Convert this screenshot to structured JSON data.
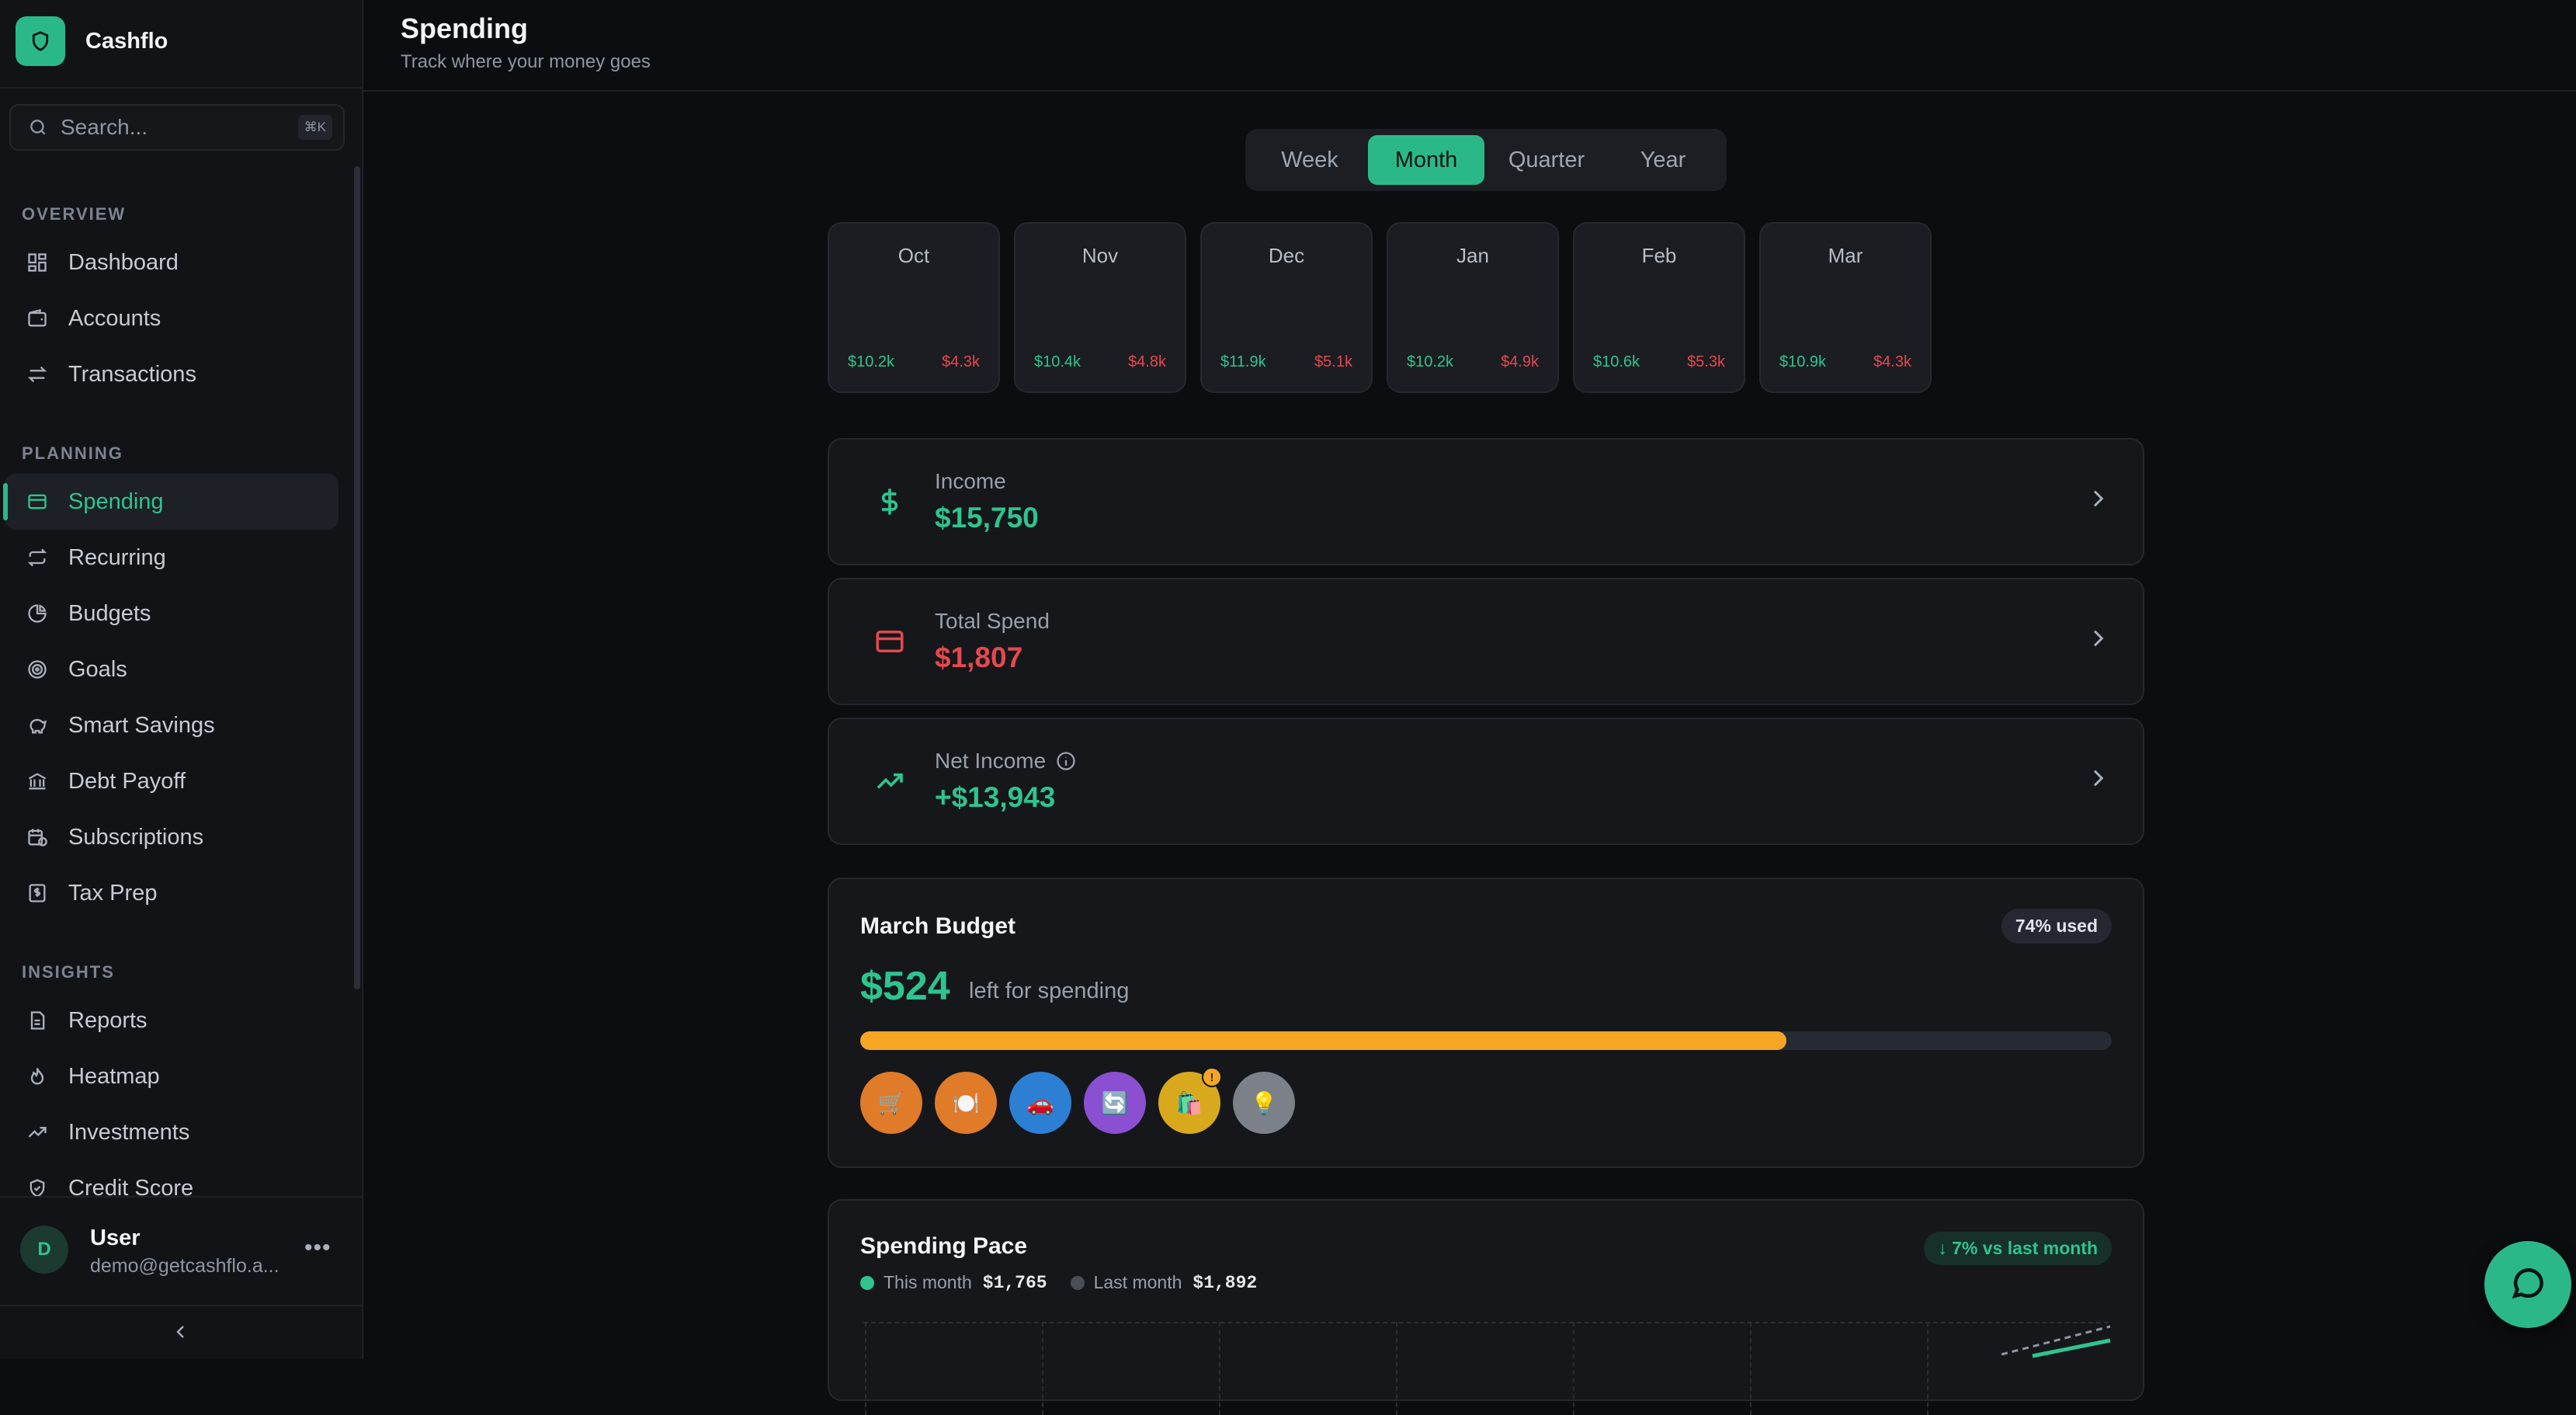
{
  "app": {
    "name": "Cashflo"
  },
  "search": {
    "placeholder": "Search...",
    "shortcut": "⌘K"
  },
  "nav": {
    "sections": [
      {
        "title": "OVERVIEW",
        "items": [
          {
            "label": "Dashboard",
            "icon": "dashboard-icon"
          },
          {
            "label": "Accounts",
            "icon": "wallet-icon"
          },
          {
            "label": "Transactions",
            "icon": "arrows-swap-icon"
          }
        ]
      },
      {
        "title": "PLANNING",
        "items": [
          {
            "label": "Spending",
            "icon": "credit-card-icon",
            "active": true
          },
          {
            "label": "Recurring",
            "icon": "repeat-icon"
          },
          {
            "label": "Budgets",
            "icon": "pie-chart-icon"
          },
          {
            "label": "Goals",
            "icon": "target-icon"
          },
          {
            "label": "Smart Savings",
            "icon": "piggy-bank-icon"
          },
          {
            "label": "Debt Payoff",
            "icon": "bank-icon"
          },
          {
            "label": "Subscriptions",
            "icon": "calendar-clock-icon"
          },
          {
            "label": "Tax Prep",
            "icon": "receipt-icon"
          }
        ]
      },
      {
        "title": "INSIGHTS",
        "items": [
          {
            "label": "Reports",
            "icon": "document-icon"
          },
          {
            "label": "Heatmap",
            "icon": "flame-icon"
          },
          {
            "label": "Investments",
            "icon": "trending-up-icon"
          },
          {
            "label": "Credit Score",
            "icon": "shield-check-icon"
          }
        ]
      }
    ]
  },
  "user": {
    "initial": "D",
    "name": "User",
    "email": "demo@getcashflo.a...",
    "more": "•••"
  },
  "header": {
    "title": "Spending",
    "subtitle": "Track where your money goes"
  },
  "periods": [
    {
      "label": "Week",
      "active": false
    },
    {
      "label": "Month",
      "active": true
    },
    {
      "label": "Quarter",
      "active": false
    },
    {
      "label": "Year",
      "active": false
    }
  ],
  "months": [
    {
      "name": "Oct",
      "income": "$10.2k",
      "spend": "$4.3k"
    },
    {
      "name": "Nov",
      "income": "$10.4k",
      "spend": "$4.8k"
    },
    {
      "name": "Dec",
      "income": "$11.9k",
      "spend": "$5.1k"
    },
    {
      "name": "Jan",
      "income": "$10.2k",
      "spend": "$4.9k"
    },
    {
      "name": "Feb",
      "income": "$10.6k",
      "spend": "$5.3k"
    },
    {
      "name": "Mar",
      "income": "$10.9k",
      "spend": "$4.3k"
    }
  ],
  "summary": {
    "income": {
      "label": "Income",
      "value": "$15,750",
      "color": "#2fc48f"
    },
    "spend": {
      "label": "Total Spend",
      "value": "$1,807",
      "color": "#e5484d"
    },
    "net": {
      "label": "Net Income",
      "value": "+$13,943",
      "color": "#2fc48f"
    }
  },
  "budget": {
    "title": "March Budget",
    "used_badge": "74% used",
    "used_fraction": 0.74,
    "left_amount": "$524",
    "left_label": "left for spending",
    "categories": [
      {
        "icon": "cart-icon",
        "glyph": "🛒",
        "color": "#e07b2a"
      },
      {
        "icon": "dining-icon",
        "glyph": "🍽️",
        "color": "#e07b2a"
      },
      {
        "icon": "car-icon",
        "glyph": "🚗",
        "color": "#2d7fd4"
      },
      {
        "icon": "refresh-icon",
        "glyph": "🔄",
        "color": "#8b4fd1"
      },
      {
        "icon": "shopping-bag-icon",
        "glyph": "🛍️",
        "color": "#d9a91d",
        "alert": "!"
      },
      {
        "icon": "lightbulb-icon",
        "glyph": "💡",
        "color": "#7b8089"
      }
    ]
  },
  "pace": {
    "title": "Spending Pace",
    "badge": "↓ 7% vs last month",
    "this_month_label": "This month",
    "this_month_value": "$1,765",
    "last_month_label": "Last month",
    "last_month_value": "$1,892"
  },
  "colors": {
    "accent": "#2bb889",
    "expense": "#e5484d",
    "warning": "#f6a623"
  }
}
